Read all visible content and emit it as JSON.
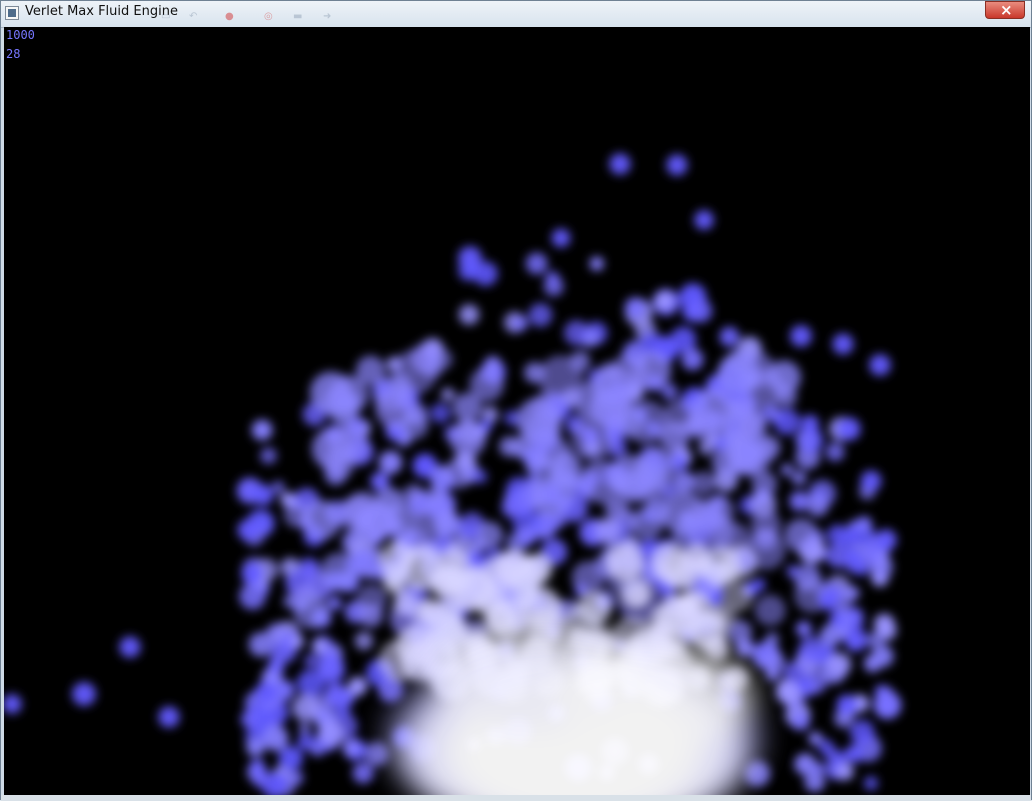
{
  "window": {
    "title": "Verlet Max Fluid Engine",
    "close_icon": "close-icon",
    "ghost_icons": [
      "save-icon",
      "undo-icon",
      "stop-icon",
      "record-icon",
      "screen-icon",
      "arrow-icon"
    ]
  },
  "simulation": {
    "particle_count": "1000",
    "fps": "28",
    "background_color": "#000000",
    "fluid_color": "#6b63ff",
    "core_color": "#ffffff"
  }
}
